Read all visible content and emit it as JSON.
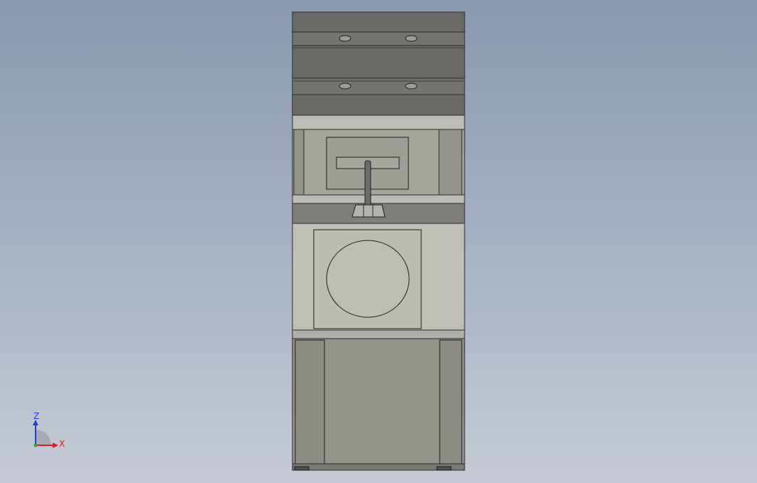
{
  "view": {
    "background_top": "#8a9ab0",
    "background_bottom": "#c6cbd6"
  },
  "colors": {
    "rail_dark": "#646461",
    "rail_mid": "#6c6c69",
    "body_light": "#bebeb6",
    "body_mid": "#a7a79f",
    "body_dark": "#8f8f87",
    "edge": "#2a2a2a",
    "axis_x": "#e02020",
    "axis_y": "#20b020",
    "axis_z": "#2040e0"
  },
  "triad": {
    "x_label": "X",
    "z_label": "Z",
    "icons": [
      "axis-x-arrow-icon",
      "axis-z-arrow-icon",
      "origin-icon"
    ]
  }
}
